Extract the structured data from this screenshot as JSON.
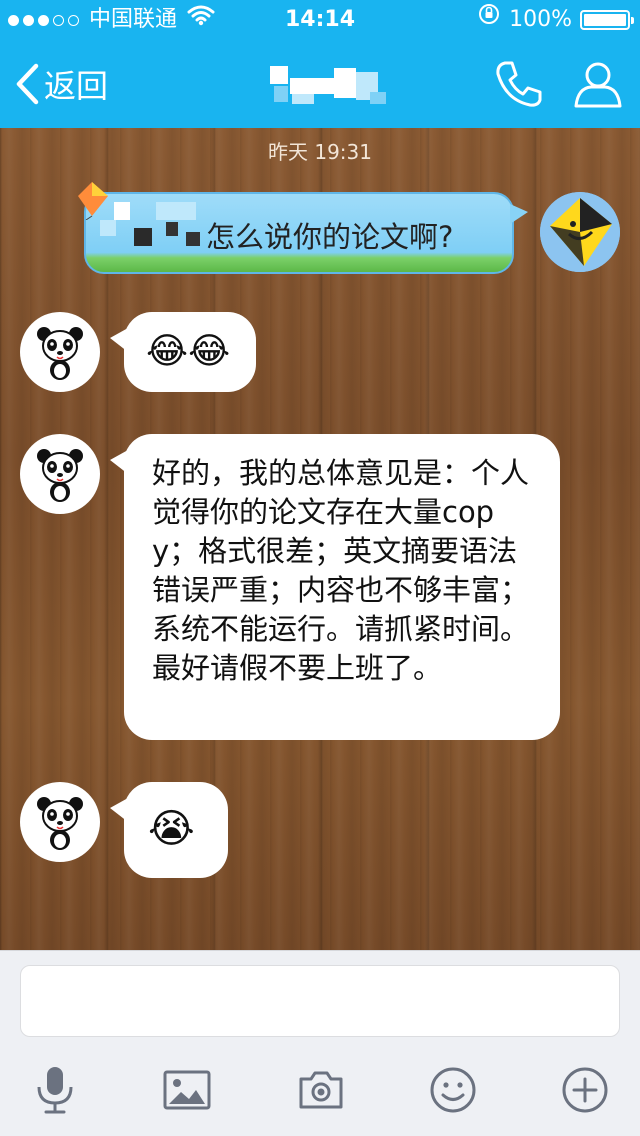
{
  "status_bar": {
    "signal_dots": [
      "on",
      "on",
      "on",
      "off",
      "off"
    ],
    "carrier": "中国联通",
    "wifi_icon": "wifi-icon",
    "time": "14:14",
    "rotation_lock_icon": "rotation-lock-icon",
    "battery_percent": "100%",
    "battery_level": 1.0
  },
  "nav": {
    "back_label": "返回",
    "title_obscured": true,
    "phone_icon": "phone-icon",
    "profile_icon": "profile-icon",
    "accent_color": "#19b4f0"
  },
  "chat": {
    "top_timestamp": "昨天 19:31",
    "messages": [
      {
        "sender": "me",
        "text": "怎么说你的论文啊?",
        "avatar_icon": "kite-smiley-avatar",
        "name_obscured": true
      },
      {
        "sender": "other",
        "text": "😂😂",
        "avatar_icon": "panda-avatar"
      },
      {
        "sender": "other",
        "text": "好的，我的总体意见是：个人觉得你的论文存在大量copy；格式很差；英文摘要语法错误严重；内容也不够丰富；系统不能运行。请抓紧时间。最好请假不要上班了。",
        "avatar_icon": "panda-avatar"
      },
      {
        "sender": "other",
        "text": "😭",
        "avatar_icon": "panda-avatar"
      }
    ]
  },
  "input_bar": {
    "text_value": "",
    "tools": [
      "microphone-icon",
      "image-icon",
      "camera-icon",
      "emoji-icon",
      "plus-icon"
    ]
  }
}
